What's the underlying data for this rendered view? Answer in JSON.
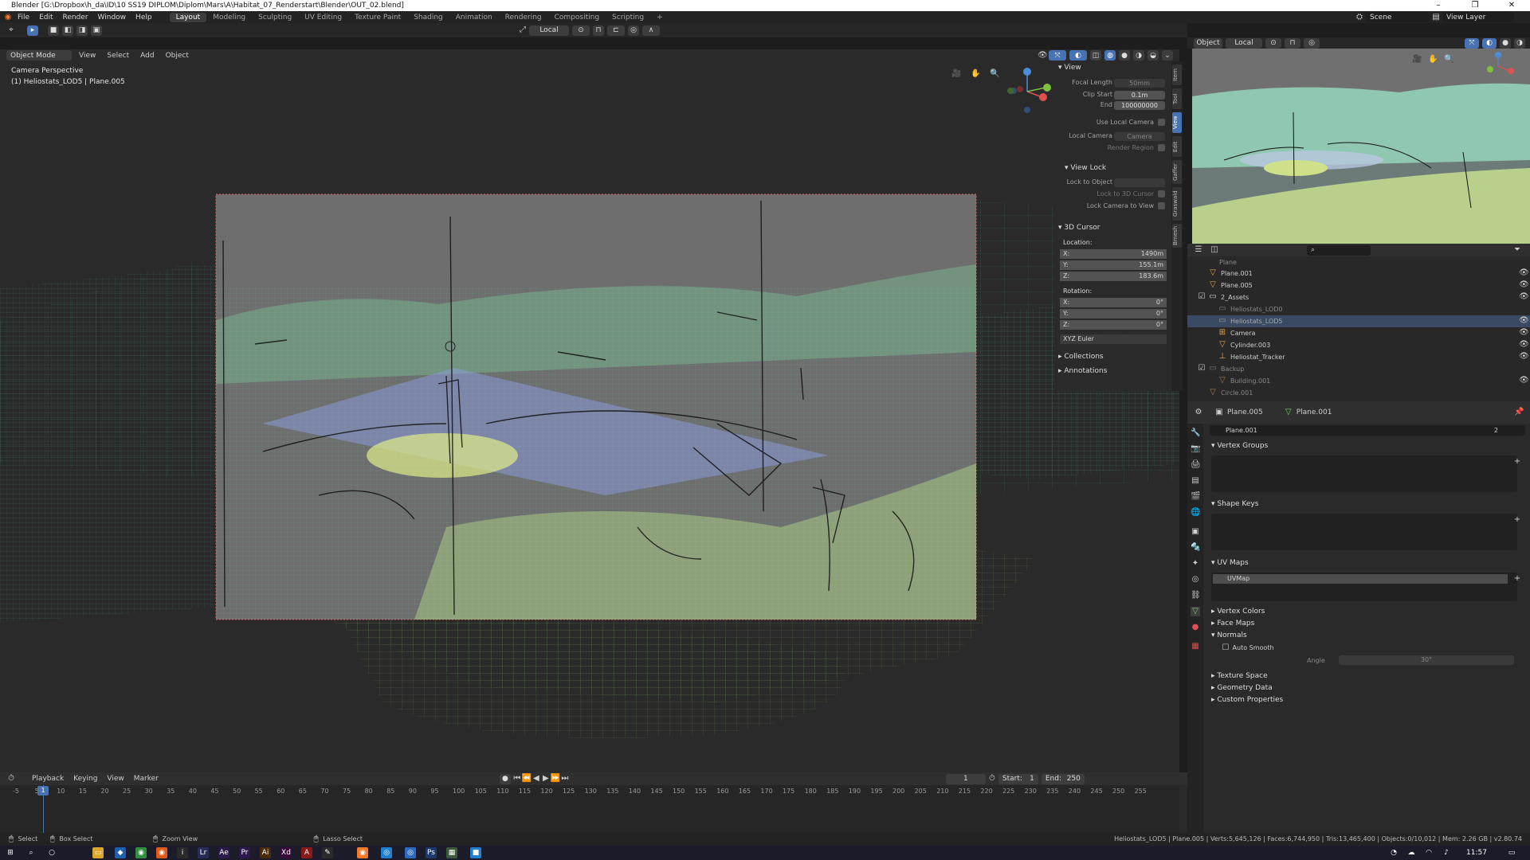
{
  "window": {
    "title": "Blender [G:\\Dropbox\\h_da\\ID\\10 SS19 DIPLOM\\Diplom\\Mars\\A\\Habitat_07_Renderstart\\Blender\\OUT_02.blend]",
    "minimize": "–",
    "maximize": "❐",
    "close": "✕"
  },
  "menu": [
    "File",
    "Edit",
    "Render",
    "Window",
    "Help"
  ],
  "workspaces": [
    {
      "label": "Layout",
      "active": true
    },
    {
      "label": "Modeling",
      "active": false
    },
    {
      "label": "Sculpting",
      "active": false
    },
    {
      "label": "UV Editing",
      "active": false
    },
    {
      "label": "Texture Paint",
      "active": false
    },
    {
      "label": "Shading",
      "active": false
    },
    {
      "label": "Animation",
      "active": false
    },
    {
      "label": "Rendering",
      "active": false
    },
    {
      "label": "Compositing",
      "active": false
    },
    {
      "label": "Scripting",
      "active": false
    }
  ],
  "add_workspace": "+",
  "top_right": {
    "scene": "Scene",
    "view_layer": "View Layer"
  },
  "viewport_toolbar": {
    "orientation": "Local"
  },
  "viewport_header": {
    "mode": "Object Mode",
    "menus": [
      "View",
      "Select",
      "Add",
      "Object"
    ]
  },
  "viewport_overlay": {
    "camera_label": "Camera Perspective",
    "object_label": "(1) Heliostats_LOD5 | Plane.005"
  },
  "npanel": {
    "tabs": [
      {
        "label": "Item",
        "active": false
      },
      {
        "label": "Tool",
        "active": false
      },
      {
        "label": "View",
        "active": true
      },
      {
        "label": "Edit",
        "active": false
      },
      {
        "label": "Gaffer",
        "active": false
      },
      {
        "label": "Graswald",
        "active": false
      },
      {
        "label": "Bmesh",
        "active": false
      }
    ],
    "view_section": "View",
    "focal_length_label": "Focal Length",
    "focal_length": "50mm",
    "clip_start_label": "Clip Start",
    "clip_start": "0.1m",
    "clip_end_label": "End",
    "clip_end": "100000000",
    "use_local_camera": "Use Local Camera",
    "local_camera_label": "Local Camera",
    "local_camera_value": "Camera",
    "render_region": "Render Region",
    "view_lock_section": "View Lock",
    "lock_to_object": "Lock to Object",
    "lock_to_3d_cursor": "Lock to 3D Cursor",
    "lock_camera_to_view": "Lock Camera to View",
    "cursor_section": "3D Cursor",
    "location_label": "Location:",
    "loc_x": "1490m",
    "loc_y": "155.1m",
    "loc_z": "183.6m",
    "rotation_label": "Rotation:",
    "rot_x": "0°",
    "rot_y": "0°",
    "rot_z": "0°",
    "rotation_mode": "XYZ Euler",
    "collections": "Collections",
    "annotations": "Annotations"
  },
  "right_header": {
    "mode": "Object",
    "orientation": "Local"
  },
  "outliner": {
    "rows": [
      {
        "label": "Plane",
        "dim": true,
        "indent": 1
      },
      {
        "label": "Plane.001",
        "dim": false,
        "indent": 1
      },
      {
        "label": "Plane.005",
        "dim": false,
        "indent": 1
      },
      {
        "label": "2_Assets",
        "dim": false,
        "indent": 0
      },
      {
        "label": "Heliostats_LOD0",
        "dim": true,
        "indent": 1
      },
      {
        "label": "Heliostats_LOD5",
        "dim": true,
        "indent": 1,
        "selected": true
      },
      {
        "label": "Camera",
        "dim": false,
        "indent": 1
      },
      {
        "label": "Cylinder.003",
        "dim": false,
        "indent": 1
      },
      {
        "label": "Heliostat_Tracker",
        "dim": false,
        "indent": 1
      },
      {
        "label": "Backup",
        "dim": true,
        "indent": 0
      },
      {
        "label": "Building.001",
        "dim": true,
        "indent": 1
      },
      {
        "label": "Circle.001",
        "dim": true,
        "indent": 0
      }
    ]
  },
  "properties": {
    "object_name": "Plane.005",
    "data_name": "Plane.001",
    "mesh_field": "Plane.001",
    "user_count": "2",
    "vertex_groups": "Vertex Groups",
    "shape_keys": "Shape Keys",
    "uv_maps": "UV Maps",
    "uv_map_item": "UVMap",
    "vertex_colors": "Vertex Colors",
    "face_maps": "Face Maps",
    "normals": "Normals",
    "auto_smooth": "Auto Smooth",
    "angle_label": "Angle",
    "angle_value": "30°",
    "texture_space": "Texture Space",
    "geometry_data": "Geometry Data",
    "custom_properties": "Custom Properties"
  },
  "timeline": {
    "menus": [
      "Playback",
      "Keying",
      "View",
      "Marker"
    ],
    "current_frame": "1",
    "start_label": "Start:",
    "start": "1",
    "end_label": "End:",
    "end": "250",
    "ruler": [
      "-5",
      "5",
      "10",
      "15",
      "20",
      "25",
      "30",
      "35",
      "40",
      "45",
      "50",
      "55",
      "60",
      "65",
      "70",
      "75",
      "80",
      "85",
      "90",
      "95",
      "100",
      "105",
      "110",
      "115",
      "120",
      "125",
      "130",
      "135",
      "140",
      "145",
      "150",
      "155",
      "160",
      "165",
      "170",
      "175",
      "180",
      "185",
      "190",
      "195",
      "200",
      "205",
      "210",
      "215",
      "220",
      "225",
      "230",
      "235",
      "240",
      "245",
      "250",
      "255"
    ],
    "frame_marker": "1"
  },
  "status": {
    "select": "Select",
    "box_select": "Box Select",
    "zoom_view": "Zoom View",
    "lasso_select": "Lasso Select",
    "stats": "Heliostats_LOD5 | Plane.005 | Verts:5,645,126 | Faces:6,744,950 | Tris:13,465,400 | Objects:0/10,012 | Mem: 2.26 GB | v2.80.74"
  },
  "taskbar": {
    "clock": "11:57"
  },
  "colors": {
    "accent": "#4772b3",
    "wire_cyan": "#6ee8c8",
    "wire_green": "#8fd36b",
    "camera_frame": "#e06060"
  }
}
